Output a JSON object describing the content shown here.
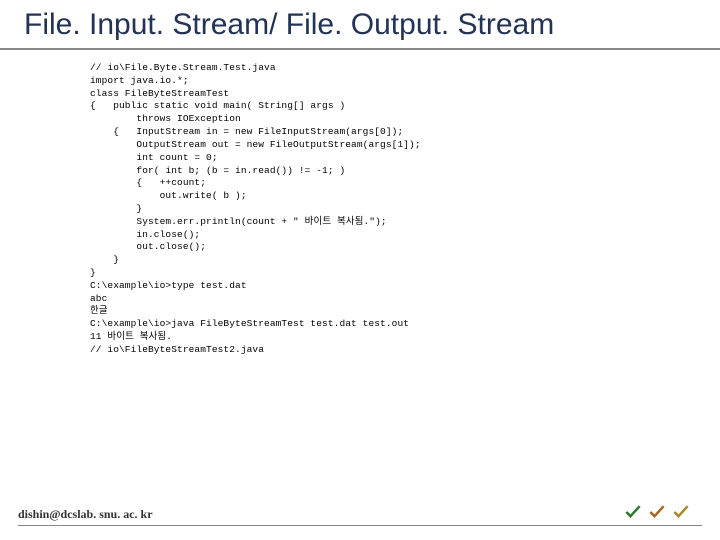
{
  "title": "File. Input. Stream/ File. Output. Stream",
  "code": [
    "// io\\File.Byte.Stream.Test.java",
    "",
    "import java.io.*;",
    "",
    "class FileByteStreamTest",
    "{   public static void main( String[] args )",
    "        throws IOException",
    "    {   InputStream in = new FileInputStream(args[0]);",
    "        OutputStream out = new FileOutputStream(args[1]);",
    "        int count = 0;",
    "        for( int b; (b = in.read()) != -1; )",
    "        {   ++count;",
    "            out.write( b );",
    "        }",
    "        System.err.println(count + \" 바이트 복사됨.\");",
    "        in.close();",
    "        out.close();",
    "    }",
    "}",
    "",
    "",
    "C:\\example\\io>type test.dat",
    "abc",
    "한글",
    "C:\\example\\io>java FileByteStreamTest test.dat test.out",
    "11 바이트 복사됨.",
    "",
    "// io\\FileByteStreamTest2.java"
  ],
  "footer": "dishin@dcslab. snu. ac. kr"
}
